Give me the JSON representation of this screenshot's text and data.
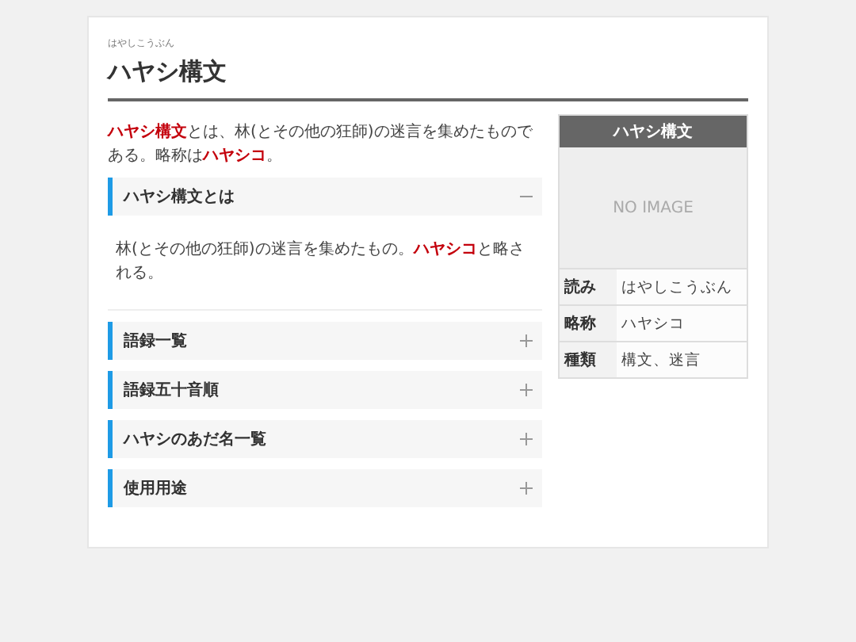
{
  "article": {
    "ruby": "はやしこうぶん",
    "title": "ハヤシ構文",
    "intro": "**ハヤシ構文**とは、林(とその他の狂師)の迷言を集めたものである。略称は**ハヤシコ**。"
  },
  "sections": [
    {
      "title": "ハヤシ構文とは",
      "expanded": true,
      "body": "林(とその他の狂師)の迷言を集めたもの。**ハヤシコ**と略される。"
    },
    {
      "title": "語録一覧",
      "expanded": false
    },
    {
      "title": "語録五十音順",
      "expanded": false
    },
    {
      "title": "ハヤシのあだ名一覧",
      "expanded": false
    },
    {
      "title": "使用用途",
      "expanded": false
    }
  ],
  "infobox": {
    "title": "ハヤシ構文",
    "image_placeholder": "NO IMAGE",
    "rows": [
      {
        "label": "読み",
        "value": "はやしこうぶん"
      },
      {
        "label": "略称",
        "value": "ハヤシコ"
      },
      {
        "label": "種類",
        "value": "構文、迷言"
      }
    ]
  }
}
